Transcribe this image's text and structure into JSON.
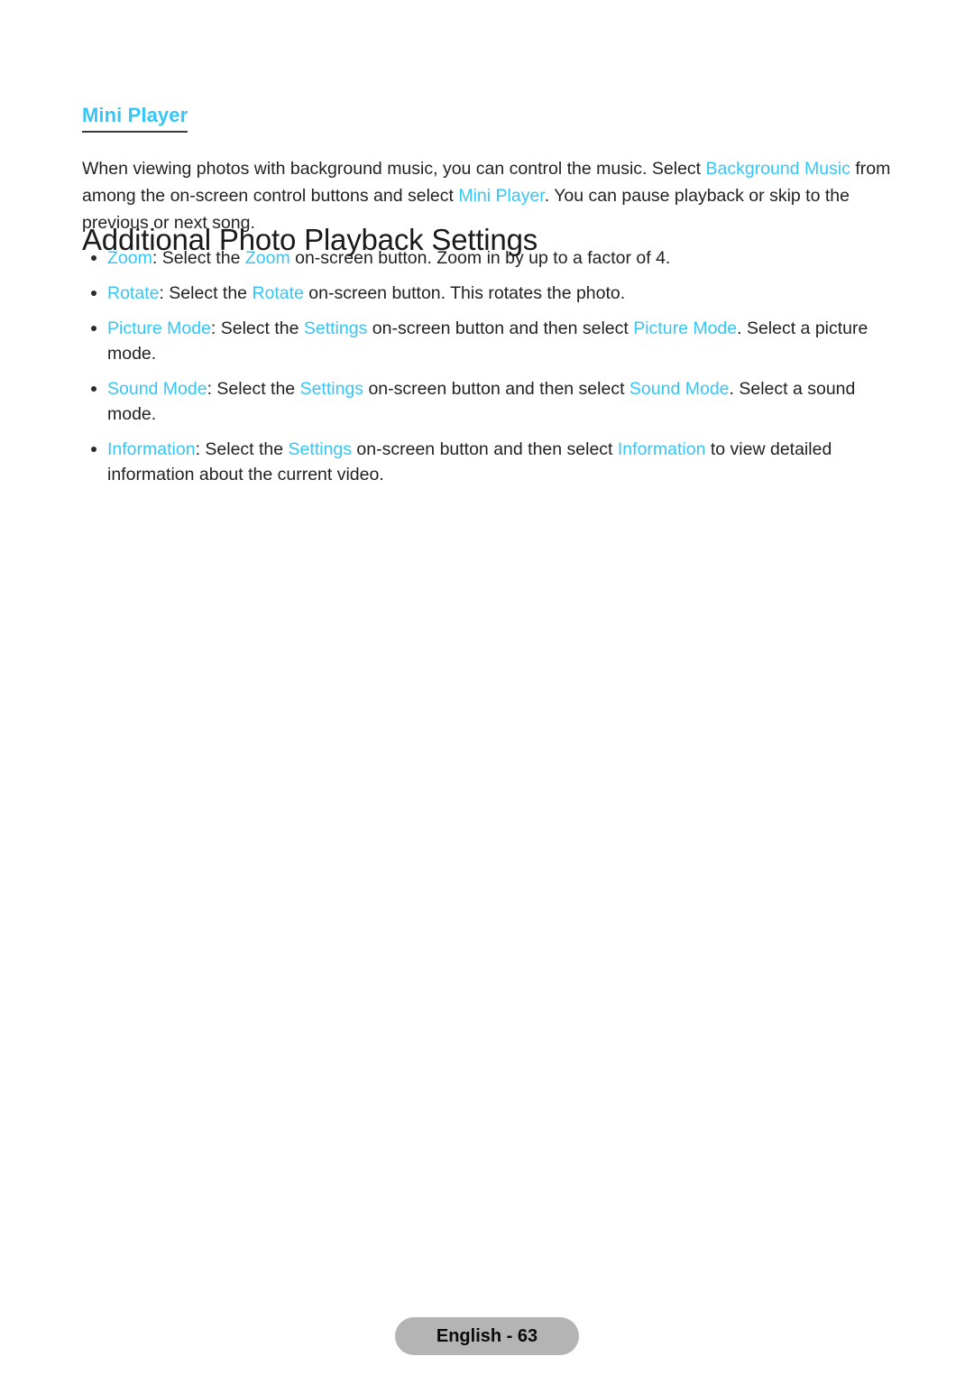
{
  "theme": {
    "accent_color": "#35c6f5",
    "text_color": "#231f20",
    "heading_color": "#1a1a1a",
    "footer_pill_bg": "#b4b4b4",
    "page_bg": "#ffffff"
  },
  "sections": {
    "subheading": {
      "label": "Mini Player"
    },
    "intro": {
      "part1": "When viewing photos with background music, you can control the music. Select ",
      "term1": "Background Music",
      "part2": " from among the on-screen control buttons and select ",
      "term2": "Mini Player",
      "part3": ". You can pause playback or skip to the previous or next song."
    },
    "heading": {
      "label": "Additional Photo Playback Settings"
    }
  },
  "bullets": [
    {
      "term": "Zoom",
      "text_a": ": Select the ",
      "term_b": "Zoom",
      "text_b": " on-screen button. Zoom in by up to a factor of 4.",
      "term_c": "",
      "text_c": ""
    },
    {
      "term": "Rotate",
      "text_a": ": Select the ",
      "term_b": "Rotate",
      "text_b": " on-screen button. This rotates the photo.",
      "term_c": "",
      "text_c": ""
    },
    {
      "term": "Picture Mode",
      "text_a": ": Select the ",
      "term_b": "Settings",
      "text_b": " on-screen button and then select ",
      "term_c": "Picture Mode",
      "text_c": ". Select a picture mode."
    },
    {
      "term": "Sound Mode",
      "text_a": ": Select the ",
      "term_b": "Settings",
      "text_b": " on-screen button and then select ",
      "term_c": "Sound Mode",
      "text_c": ". Select a sound mode."
    },
    {
      "term": "Information",
      "text_a": ": Select the ",
      "term_b": "Settings",
      "text_b": " on-screen button and then select ",
      "term_c": "Information",
      "text_c": " to view detailed information about the current video."
    }
  ],
  "footer": {
    "page_label": "English - 63"
  }
}
